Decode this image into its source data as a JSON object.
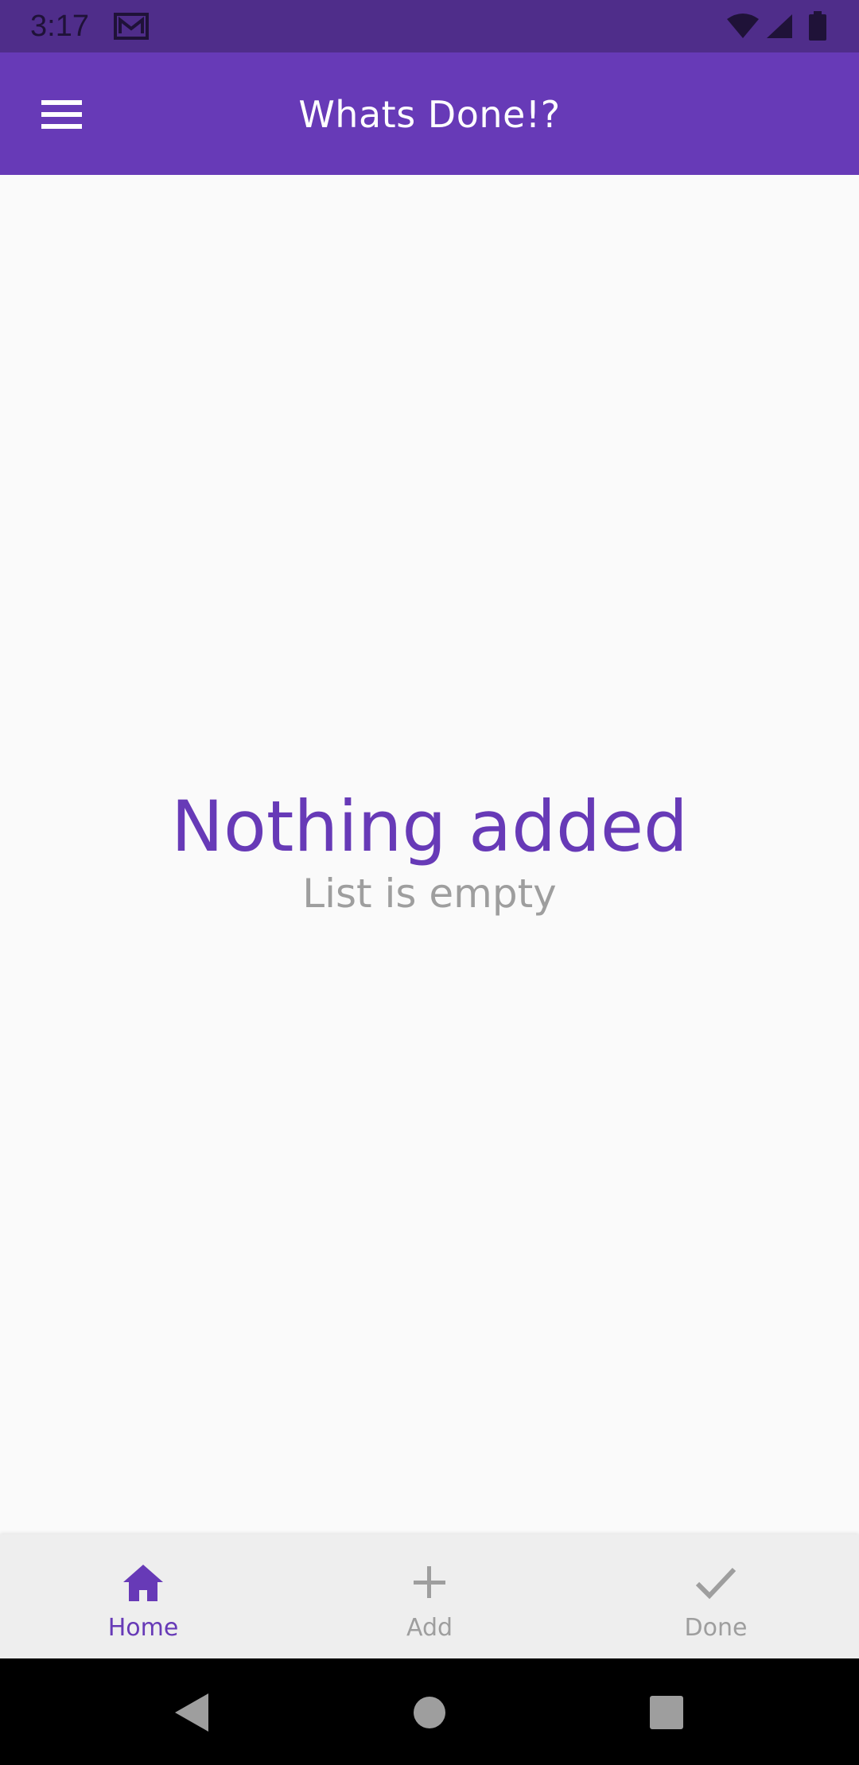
{
  "status_bar": {
    "time": "3:17",
    "icons": [
      "gmail-icon",
      "wifi-icon",
      "signal-icon",
      "battery-icon"
    ]
  },
  "app_bar": {
    "title": "Whats Done!?",
    "menu_icon": "menu-icon",
    "color": "#673ab7"
  },
  "empty_state": {
    "title": "Nothing added",
    "subtitle": "List is empty"
  },
  "bottom_nav": {
    "items": [
      {
        "label": "Home",
        "icon": "home-icon",
        "active": true
      },
      {
        "label": "Add",
        "icon": "add-icon",
        "active": false
      },
      {
        "label": "Done",
        "icon": "check-icon",
        "active": false
      }
    ],
    "active_color": "#673ab7",
    "inactive_color": "#9e9e9e"
  },
  "system_nav": {
    "buttons": [
      "back-icon",
      "home-circle-icon",
      "recents-icon"
    ]
  }
}
